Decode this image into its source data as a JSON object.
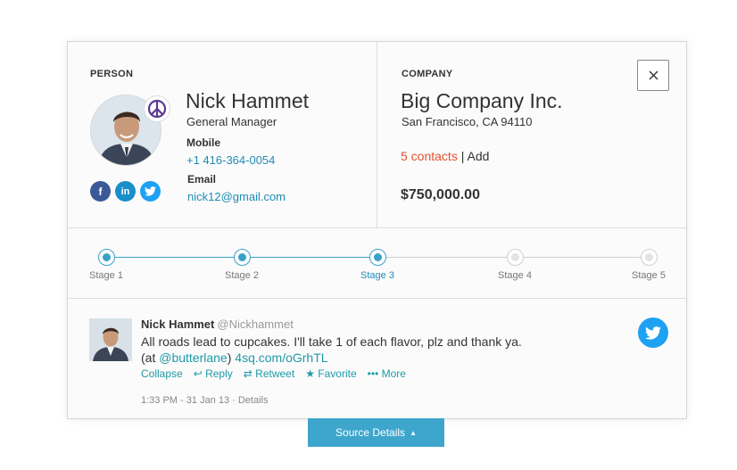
{
  "person": {
    "section_label": "PERSON",
    "name": "Nick Hammet",
    "title": "General Manager",
    "mobile_label": "Mobile",
    "mobile": "+1 416-364-0054",
    "email_label": "Email",
    "email": "nick12@gmail.com",
    "badge_icon": "peace-icon",
    "socials": [
      "facebook-icon",
      "linkedin-icon",
      "twitter-icon"
    ],
    "social_glyphs": {
      "facebook": "f",
      "linkedin": "in"
    }
  },
  "company": {
    "section_label": "COMPANY",
    "name": "Big Company Inc.",
    "address": "San Francisco, CA 94110",
    "contacts_link": "5 contacts",
    "separator": " | ",
    "add_link": "Add",
    "amount": "$750,000.00"
  },
  "close_icon": "close-icon",
  "stages": [
    {
      "label": "Stage 1",
      "state": "done"
    },
    {
      "label": "Stage 2",
      "state": "done"
    },
    {
      "label": "Stage 3",
      "state": "current"
    },
    {
      "label": "Stage 4",
      "state": "inactive"
    },
    {
      "label": "Stage 5",
      "state": "inactive"
    }
  ],
  "tweet": {
    "name": "Nick Hammet",
    "handle": "@Nickhammet",
    "text_before": "All roads lead to cupcakes. I'll take 1 of each flavor, plz and thank ya. (at ",
    "mention": "@butterlane",
    "text_mid": ") ",
    "url": "4sq.com/oGrhTL",
    "actions": {
      "collapse": "Collapse",
      "reply": "Reply",
      "retweet": "Retweet",
      "favorite": "Favorite",
      "more": "More"
    },
    "timestamp": "1:33 PM - 31 Jan 13",
    "details": "Details",
    "meta_separator": " · "
  },
  "source_button": {
    "label": "Source Details",
    "arrow": "▲"
  },
  "colors": {
    "accent": "#3ea6cd",
    "link": "#1f8bb5",
    "contacts": "#e8502f",
    "twitter": "#1da1f2",
    "facebook": "#3b5998",
    "linkedin": "#1a8fc9"
  }
}
